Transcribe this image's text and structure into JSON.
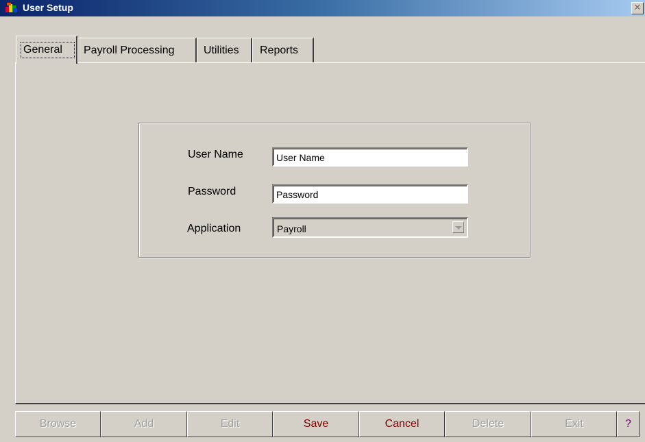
{
  "window": {
    "title": "User Setup",
    "close_glyph": "✕"
  },
  "tabs": [
    {
      "label": "General",
      "active": true
    },
    {
      "label": "Payroll Processing",
      "active": false
    },
    {
      "label": "Utilities",
      "active": false
    },
    {
      "label": "Reports",
      "active": false
    }
  ],
  "form": {
    "user_name_label": "User Name",
    "user_name_value": "User Name",
    "password_label": "Password",
    "password_value": "Password",
    "application_label": "Application",
    "application_value": "Payroll"
  },
  "buttons": [
    {
      "label": "Browse",
      "enabled": false
    },
    {
      "label": "Add",
      "enabled": false
    },
    {
      "label": "Edit",
      "enabled": false
    },
    {
      "label": "Save",
      "enabled": true
    },
    {
      "label": "Cancel",
      "enabled": true
    },
    {
      "label": "Delete",
      "enabled": false
    },
    {
      "label": "Exit",
      "enabled": false
    },
    {
      "label": "?",
      "enabled": true
    }
  ],
  "colors": {
    "enabled_button_text": "#7a0000",
    "help_text": "#800080",
    "titlebar_start": "#0a246a"
  }
}
